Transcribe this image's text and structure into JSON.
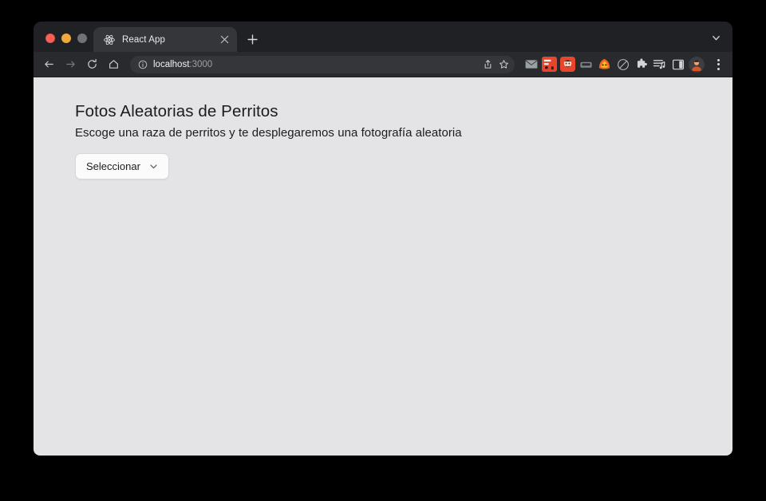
{
  "window": {
    "traffic_lights": [
      "close",
      "minimize",
      "zoom"
    ],
    "tab_list_icon": "chevron-down-icon"
  },
  "tab_strip": {
    "tabs": [
      {
        "title": "React App",
        "favicon": "react-logo-icon",
        "close_icon": "close-icon",
        "active": true
      }
    ],
    "new_tab_icon": "plus-icon"
  },
  "toolbar": {
    "back_icon": "arrow-left-icon",
    "forward_icon": "arrow-right-icon",
    "reload_icon": "reload-icon",
    "home_icon": "home-icon",
    "omnibox": {
      "info_icon": "info-circle-icon",
      "host": "localhost",
      "port": ":3000",
      "share_icon": "share-icon",
      "bookmark_icon": "star-icon"
    },
    "extensions": [
      {
        "name": "mail-extension-icon",
        "type": "mail"
      },
      {
        "name": "red-extension-icon",
        "type": "red1"
      },
      {
        "name": "gift-extension-icon",
        "type": "red2"
      },
      {
        "name": "dark-extension-icon",
        "type": "grey"
      },
      {
        "name": "orange-extension-icon",
        "type": "orange"
      },
      {
        "name": "adblock-extension-icon",
        "type": "circle-slash"
      },
      {
        "name": "puzzle-extensions-icon",
        "type": "puzzle"
      },
      {
        "name": "playlist-extension-icon",
        "type": "playlist"
      },
      {
        "name": "side-panel-icon",
        "type": "panel"
      }
    ],
    "avatar_icon": "profile-avatar",
    "menu_icon": "three-dots-menu-icon"
  },
  "page": {
    "title": "Fotos Aleatorias de Perritos",
    "subtitle": "Escoge una raza de perritos y te desplegaremos una fotografía aleatoria",
    "select": {
      "label": "Seleccionar",
      "chevron_icon": "chevron-down-icon"
    }
  },
  "colors": {
    "desktop_background": "#000000",
    "browser_chrome": "#202124",
    "toolbar": "#292a2d",
    "active_tab": "#35363a",
    "page_background": "#e4e4e7",
    "text_primary": "#1c1c1e",
    "omnibox_background": "#35363a"
  }
}
